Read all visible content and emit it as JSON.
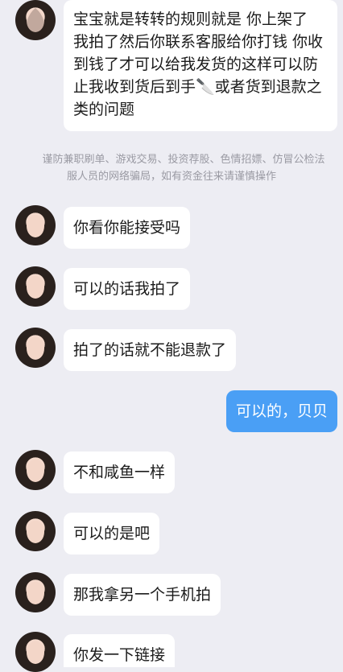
{
  "messages": [
    {
      "side": "left",
      "text": "宝宝就是转转的规则就是 你上架了 我拍了然后你联系客服给你打钱 你收到钱了才可以给我发货的这样可以防止我收到货后到手🔪或者货到退款之类的问题"
    },
    {
      "side": "left",
      "text": "你看你能接受吗"
    },
    {
      "side": "left",
      "text": "可以的话我拍了"
    },
    {
      "side": "left",
      "text": "拍了的话就不能退款了"
    },
    {
      "side": "right",
      "text": "可以的，贝贝"
    },
    {
      "side": "left",
      "text": "不和咸鱼一样"
    },
    {
      "side": "left",
      "text": "可以的是吧"
    },
    {
      "side": "left",
      "text": "那我拿另一个手机拍"
    },
    {
      "side": "left",
      "text": "你发一下链接"
    }
  ],
  "notice": {
    "line1": "谨防兼职刷单、游戏交易、投资荐股、色情招嫖、仿冒公检法",
    "line2": "服人员的网络骗局，如有资金往来请谨慎操作"
  }
}
